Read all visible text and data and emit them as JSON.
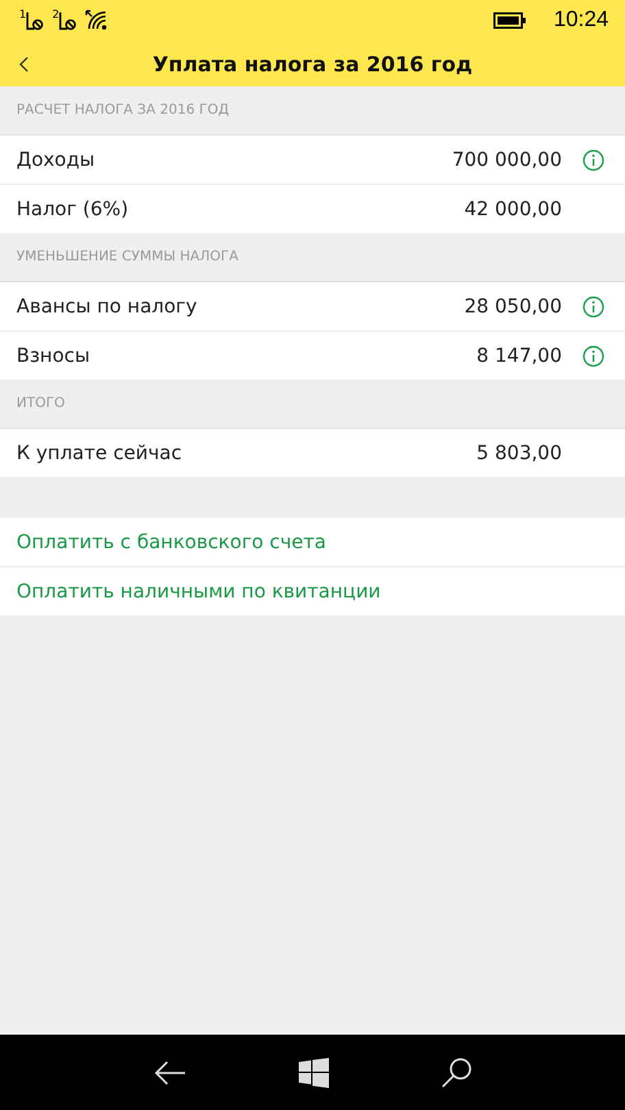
{
  "status_bar": {
    "sims": [
      "1",
      "2"
    ],
    "time": "10:24"
  },
  "header": {
    "title": "Уплата налога за 2016 год"
  },
  "sections": [
    {
      "title": "РАСЧЕТ НАЛОГА ЗА 2016 ГОД",
      "rows": [
        {
          "label": "Доходы",
          "value": "700 000,00",
          "info": true
        },
        {
          "label": "Налог (6%)",
          "value": "42 000,00",
          "info": false
        }
      ]
    },
    {
      "title": "УМЕНЬШЕНИЕ СУММЫ НАЛОГА",
      "rows": [
        {
          "label": "Авансы по налогу",
          "value": "28 050,00",
          "info": true
        },
        {
          "label": "Взносы",
          "value": "8 147,00",
          "info": true
        }
      ]
    },
    {
      "title": "ИТОГО",
      "rows": [
        {
          "label": "К уплате сейчас",
          "value": "5 803,00",
          "info": false
        }
      ]
    }
  ],
  "actions": [
    "Оплатить с банковского счета",
    "Оплатить наличными по квитанции"
  ]
}
